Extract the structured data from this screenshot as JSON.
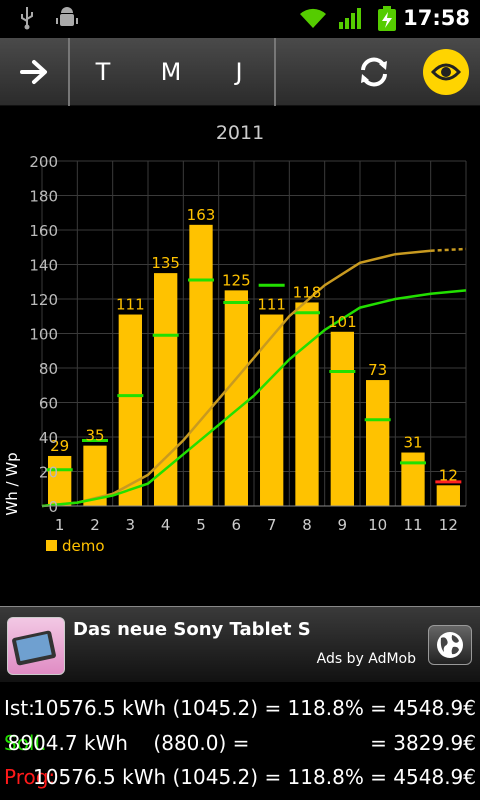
{
  "status_bar": {
    "time": "17:58",
    "icons": [
      "usb-icon",
      "android-debug-icon",
      "wifi-icon",
      "signal-icon",
      "battery-charging-icon"
    ]
  },
  "toolbar": {
    "forward_icon": "arrow-right-icon",
    "tabs": [
      "T",
      "M",
      "J"
    ],
    "refresh_icon": "refresh-icon",
    "eye_icon": "eye-icon",
    "accent_color": "#ffd400"
  },
  "chart_data": {
    "type": "bar",
    "title": "2011",
    "ylabel": "Wh / Wp",
    "xlabel": "",
    "ylim": [
      0,
      200
    ],
    "yticks": [
      0,
      20,
      40,
      60,
      80,
      100,
      120,
      140,
      160,
      180,
      200
    ],
    "categories": [
      "1",
      "2",
      "3",
      "4",
      "5",
      "6",
      "7",
      "8",
      "9",
      "10",
      "11",
      "12"
    ],
    "series": [
      {
        "name": "demo",
        "color": "#ffc200",
        "values": [
          29,
          35,
          111,
          135,
          163,
          125,
          111,
          118,
          101,
          73,
          31,
          12
        ]
      }
    ],
    "data_labels": [
      "29",
      "35",
      "111",
      "135",
      "163",
      "125",
      "111",
      "118",
      "101",
      "73",
      "31",
      "12"
    ],
    "target_marks": {
      "color": "#22e000",
      "values": [
        21,
        38,
        64,
        99,
        131,
        118,
        128,
        112,
        78,
        50,
        25,
        14
      ]
    },
    "cumulative_actual": {
      "color": "#c89a20",
      "values": [
        0,
        2,
        7,
        18,
        38,
        62,
        86,
        110,
        128,
        141,
        146,
        148,
        149
      ]
    },
    "cumulative_target": {
      "color": "#22e000",
      "values": [
        0,
        2,
        6,
        13,
        30,
        47,
        64,
        85,
        102,
        115,
        120,
        123,
        125
      ]
    },
    "legend_position": "bottom-left",
    "grid": true
  },
  "ad": {
    "title": "Das neue Sony Tablet S",
    "by": "Ads by AdMob",
    "globe_icon": "globe-icon"
  },
  "summary": {
    "rows": [
      {
        "label": "Ist:",
        "value": "10576.5 kWh (1045.2) = 118.8% = 4548.9€",
        "color": "#ffffff"
      },
      {
        "label": "Soll:",
        "value": "8904.7 kWh    (880.0) =                   = 3829.9€",
        "color": "#22e000"
      },
      {
        "label": "Prog:",
        "value": "10576.5 kWh (1045.2) = 118.8% = 4548.9€",
        "color": "#ff1a1a"
      }
    ]
  }
}
